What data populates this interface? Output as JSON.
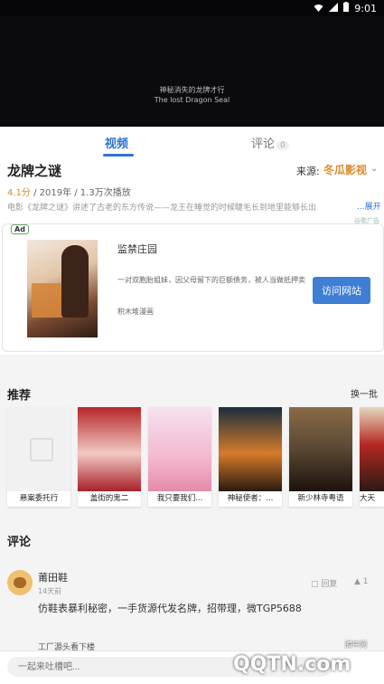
{
  "status_bar": {
    "time": "9:01"
  },
  "video": {
    "subtitle_cn": "神秘消失的龙牌才行",
    "subtitle_en": "The lost Dragon Seal"
  },
  "tabs": {
    "video": "视频",
    "comments": "评论",
    "comments_count": "0"
  },
  "movie": {
    "title": "龙牌之谜",
    "source_label": "来源:",
    "source_name": "冬瓜影视",
    "rating": "4.1分",
    "meta": " / 2019年 / 1.3万次播放",
    "description": "电影《龙牌之谜》讲述了古老的东方传说——龙王在睡觉的时候睫毛长到地里能够长出",
    "expand": "...展开"
  },
  "ad": {
    "label": "谷歌广告",
    "badge": "Ad",
    "title": "监禁庄园",
    "description": "一对双胞胎姐妹，因父母留下的巨额债务，被人当做抵押卖",
    "brand": "积木堆漫画",
    "button": "访问网站"
  },
  "recommend": {
    "title": "推荐",
    "more": "换一批",
    "items": [
      {
        "caption": "悬案委托行"
      },
      {
        "caption": "盖街的鬼二"
      },
      {
        "caption": "我只要我们..."
      },
      {
        "caption": "神秘使者：..."
      },
      {
        "caption": "新少林寺粤语"
      },
      {
        "caption": "大天"
      }
    ]
  },
  "comments": {
    "title": "评论",
    "items": [
      {
        "name": "莆田鞋",
        "time": "14天前",
        "text": "仿鞋表暴利秘密，一手货源代发名牌，招带理，微TGP5688",
        "reply": "回复",
        "likes": "1"
      }
    ],
    "next_partial": "工厂源头看下楼"
  },
  "bottom": {
    "placeholder": "一起来吐槽吧...",
    "watermark_site": "腾牛网",
    "watermark_logo": "QQTN.com"
  }
}
